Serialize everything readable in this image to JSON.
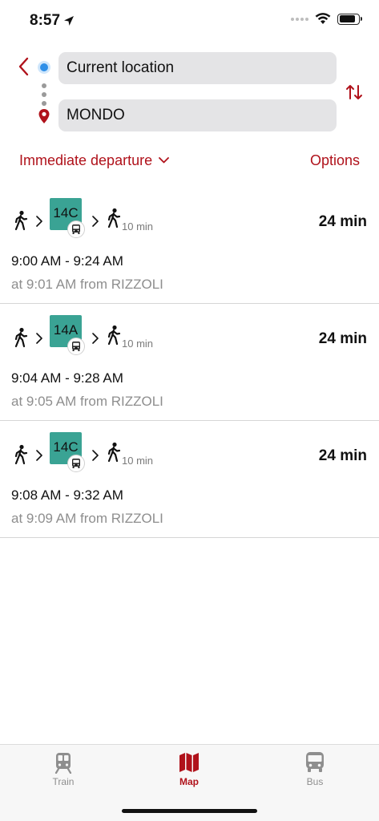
{
  "status_bar": {
    "time": "8:57",
    "battery_level": 0.85
  },
  "search": {
    "from_value": "Current location",
    "to_value": "MONDO",
    "departure_label": "Immediate departure",
    "options_label": "Options"
  },
  "results": [
    {
      "line": "14C",
      "walk_time": "10 min",
      "duration": "24 min",
      "times": "9:00 AM - 9:24 AM",
      "departure_info": "at 9:01 AM from RIZZOLI"
    },
    {
      "line": "14A",
      "walk_time": "10 min",
      "duration": "24 min",
      "times": "9:04 AM - 9:28 AM",
      "departure_info": "at 9:05 AM from RIZZOLI"
    },
    {
      "line": "14C",
      "walk_time": "10 min",
      "duration": "24 min",
      "times": "9:08 AM - 9:32 AM",
      "departure_info": "at 9:09 AM from RIZZOLI"
    }
  ],
  "tabs": [
    {
      "label": "Train",
      "icon": "train-icon",
      "active": false
    },
    {
      "label": "Map",
      "icon": "map-icon",
      "active": true
    },
    {
      "label": "Bus",
      "icon": "bus-icon",
      "active": false
    }
  ],
  "colors": {
    "accent": "#b0121b",
    "line_badge": "#3aa394",
    "origin_dot": "#2f8fe8",
    "field_bg": "#e4e4e6"
  }
}
